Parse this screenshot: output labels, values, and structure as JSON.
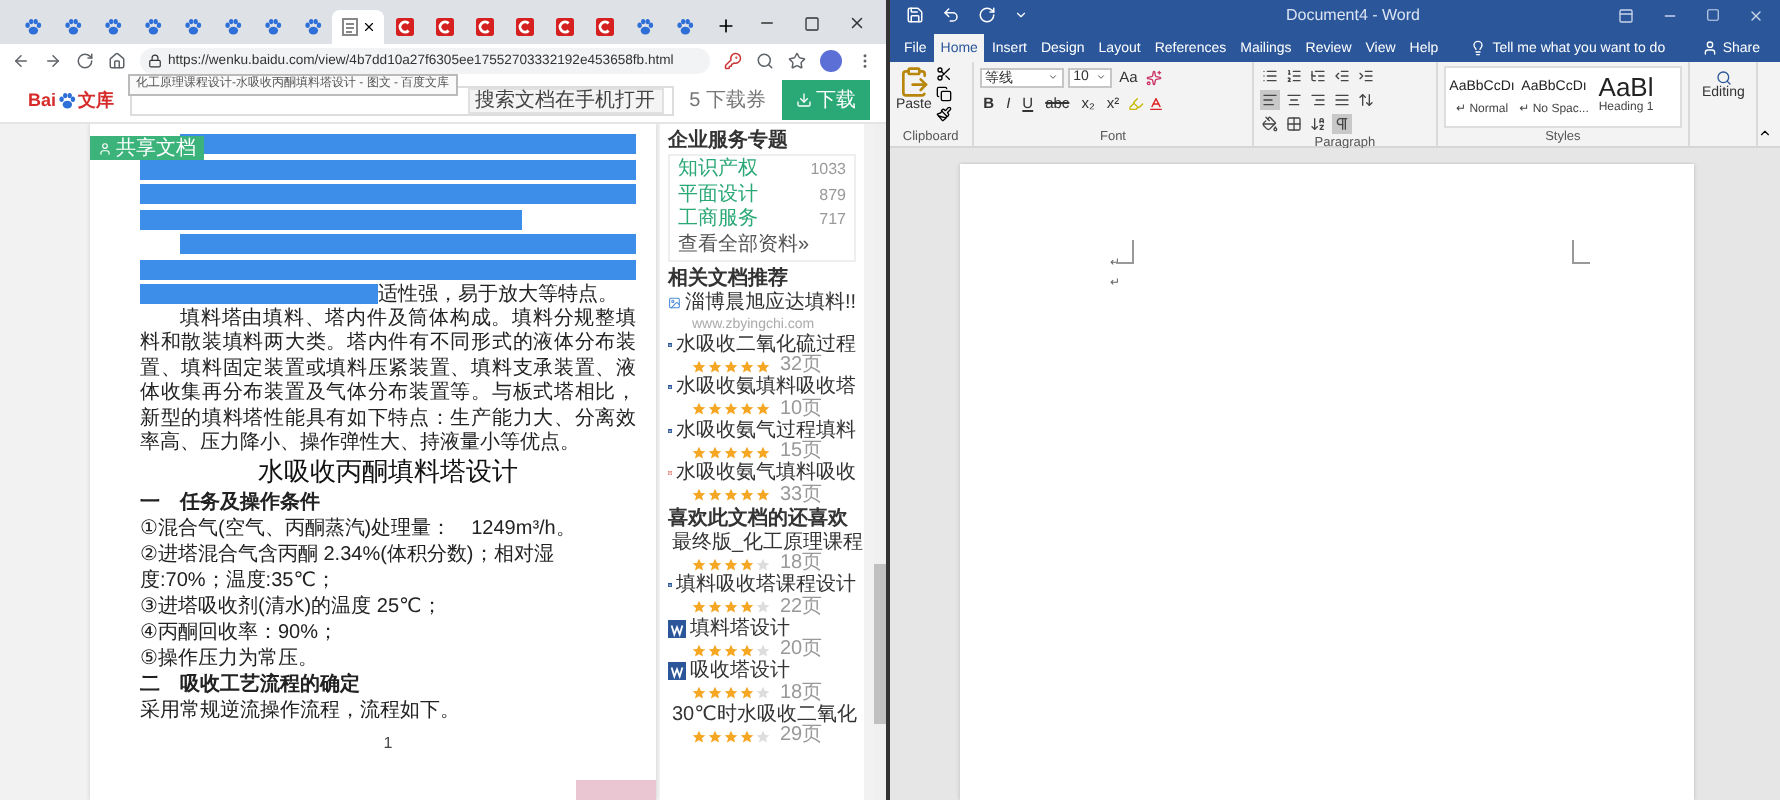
{
  "browser": {
    "tabs": [
      {
        "kind": "baidu",
        "selected": false
      },
      {
        "kind": "baidu",
        "selected": false
      },
      {
        "kind": "baidu",
        "selected": false
      },
      {
        "kind": "baidu",
        "selected": false
      },
      {
        "kind": "baidu",
        "selected": false
      },
      {
        "kind": "baidu",
        "selected": false
      },
      {
        "kind": "baidu",
        "selected": false
      },
      {
        "kind": "baidu",
        "selected": false
      },
      {
        "kind": "doc",
        "selected": true
      },
      {
        "kind": "csdn",
        "selected": false
      },
      {
        "kind": "csdn",
        "selected": false
      },
      {
        "kind": "csdn",
        "selected": false
      },
      {
        "kind": "csdn",
        "selected": false
      },
      {
        "kind": "csdn",
        "selected": false
      },
      {
        "kind": "csdn",
        "selected": false
      },
      {
        "kind": "baidu",
        "selected": false
      },
      {
        "kind": "baidu",
        "selected": false
      }
    ],
    "url": "https://wenku.baidu.com/view/4b7dd10a27f6305ee17552703332192e453658fb.html",
    "url_tooltip": "化工原理课程设计-水吸收丙酮填料塔设计 - 图文 - 百度文库"
  },
  "site_header": {
    "logo_latin": "Bai",
    "logo_cjk": "文库",
    "phone_open": "搜索文档在手机打开",
    "coupons": "5 下载券",
    "download": "下载"
  },
  "share_tag": "共享文档",
  "document": {
    "blocks": [
      {
        "kind": "highlighted"
      },
      {
        "kind": "highlighted",
        "tail": "适性强，易于放大等特点。"
      },
      {
        "kind": "para",
        "text": "填料塔由填料、塔内件及筒体构成。填料分规整填料和散装填料两大类。塔内件有不同形式的液体分布装置、填料固定装置或填料压紧装置、填料支承装置、液体收集再分布装置及气体分布装置等。与板式塔相比，新型的填料塔性能具有如下特点：生产能力大、分离效率高、压力降小、操作弹性大、持液量小等优点。"
      },
      {
        "kind": "title",
        "text": "水吸收丙酮填料塔设计"
      },
      {
        "kind": "heading",
        "text": "一　任务及操作条件"
      },
      {
        "kind": "item",
        "text": "①混合气(空气、丙酮蒸汽)处理量：　1249m³/h。"
      },
      {
        "kind": "item",
        "text": "②进塔混合气含丙酮 2.34%(体积分数)；相对湿度:70%；温度:35℃；"
      },
      {
        "kind": "item",
        "text": "③进塔吸收剂(清水)的温度 25℃；"
      },
      {
        "kind": "item",
        "text": "④丙酮回收率：90%；"
      },
      {
        "kind": "item",
        "text": "⑤操作压力为常压。"
      },
      {
        "kind": "heading",
        "text": "二　吸收工艺流程的确定"
      },
      {
        "kind": "item",
        "text": "采用常规逆流操作流程，流程如下。"
      }
    ],
    "page_number": "1"
  },
  "sidebar": {
    "services": {
      "title": "企业服务专题",
      "items": [
        {
          "label": "知识产权",
          "count": "1033"
        },
        {
          "label": "平面设计",
          "count": "879"
        },
        {
          "label": "工商服务",
          "count": "717"
        }
      ],
      "more": "查看全部资料»"
    },
    "related": {
      "title": "相关文档推荐",
      "items": [
        {
          "kind": "image",
          "title": "淄博晨旭应达填料!!",
          "subtitle": "www.zbyingchi.com"
        },
        {
          "kind": "word",
          "title": "水吸收二氧化硫过程",
          "stars": 5,
          "pages": "32页"
        },
        {
          "kind": "word",
          "title": "水吸收氨填料吸收塔",
          "stars": 5,
          "pages": "10页"
        },
        {
          "kind": "word",
          "title": "水吸收氨气过程填料",
          "stars": 5,
          "pages": "15页"
        },
        {
          "kind": "pdf",
          "title": "水吸收氨气填料吸收",
          "stars": 5,
          "pages": "33页"
        }
      ]
    },
    "also_liked": {
      "title": "喜欢此文档的还喜欢",
      "items": [
        {
          "kind": "word",
          "title": "最终版_化工原理课程",
          "stars": 4,
          "pages": "18页"
        },
        {
          "kind": "word",
          "title": "填料吸收塔课程设计",
          "stars": 4,
          "pages": "22页"
        },
        {
          "kind": "word",
          "title": "填料塔设计",
          "stars": 4,
          "pages": "20页"
        },
        {
          "kind": "word",
          "title": "吸收塔设计",
          "stars": 4,
          "pages": "18页"
        },
        {
          "kind": "word",
          "title": "30℃时水吸收二氧化",
          "stars": 4,
          "pages": "29页"
        }
      ]
    }
  },
  "word": {
    "title": "Document4 - Word",
    "tabs": [
      {
        "label": "File",
        "selected": false
      },
      {
        "label": "Home",
        "selected": true
      },
      {
        "label": "Insert",
        "selected": false
      },
      {
        "label": "Design",
        "selected": false
      },
      {
        "label": "Layout",
        "selected": false
      },
      {
        "label": "References",
        "selected": false
      },
      {
        "label": "Mailings",
        "selected": false
      },
      {
        "label": "Review",
        "selected": false
      },
      {
        "label": "View",
        "selected": false
      },
      {
        "label": "Help",
        "selected": false
      }
    ],
    "tell_me": "Tell me what you want to do",
    "share": "Share",
    "clipboard": {
      "paste": "Paste",
      "label": "Clipboard"
    },
    "font": {
      "name": "等线",
      "size": "10",
      "case_button": "Aa",
      "buttons": [
        "B",
        "I",
        "U",
        "abc",
        "x₂",
        "x²"
      ],
      "label": "Font"
    },
    "paragraph": {
      "label": "Paragraph",
      "buttons": [
        {
          "kind": "bullets",
          "selected": false
        },
        {
          "kind": "numbering",
          "selected": false
        },
        {
          "kind": "multilevel",
          "selected": false
        },
        {
          "kind": "outdent",
          "selected": false
        },
        {
          "kind": "indent",
          "selected": false
        },
        {
          "kind": "left",
          "selected": true
        },
        {
          "kind": "center",
          "selected": false
        },
        {
          "kind": "right",
          "selected": false
        },
        {
          "kind": "justify",
          "selected": false
        },
        {
          "kind": "spacing",
          "selected": false
        },
        {
          "kind": "shading",
          "selected": false
        },
        {
          "kind": "borders",
          "selected": false
        },
        {
          "kind": "sort",
          "selected": false
        },
        {
          "kind": "marks",
          "selected": true
        }
      ]
    },
    "styles": {
      "label": "Styles",
      "items": [
        {
          "kind": "body",
          "preview": "AaBbCcDı",
          "name": "↵ Normal"
        },
        {
          "kind": "body",
          "preview": "AaBbCcDı",
          "name": "↵ No Spac..."
        },
        {
          "kind": "heading",
          "preview": "AaBl",
          "name": "Heading 1"
        }
      ]
    },
    "editing": "Editing",
    "page": {
      "marks": [
        "↵",
        "↵"
      ]
    }
  }
}
